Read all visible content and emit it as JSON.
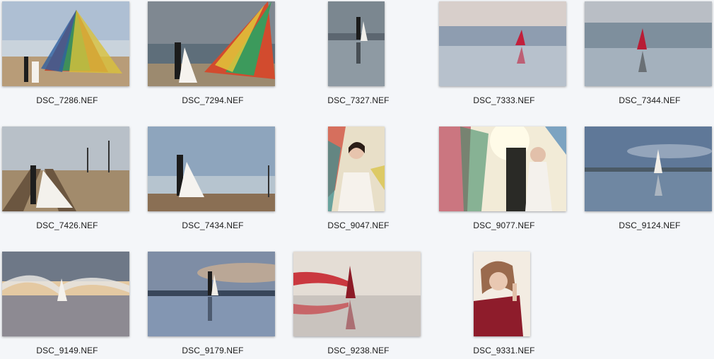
{
  "files": [
    {
      "name": "DSC_7286.NEF",
      "scene": "flags-beach"
    },
    {
      "name": "DSC_7294.NEF",
      "scene": "flags-cloudy"
    },
    {
      "name": "DSC_7327.NEF",
      "scene": "portrait-mirror-couple"
    },
    {
      "name": "DSC_7333.NEF",
      "scene": "mirror-red-dress"
    },
    {
      "name": "DSC_7344.NEF",
      "scene": "mirror-red-dress-2"
    },
    {
      "name": "DSC_7426.NEF",
      "scene": "railway-couple"
    },
    {
      "name": "DSC_7434.NEF",
      "scene": "railway-kiss"
    },
    {
      "name": "DSC_9047.NEF",
      "scene": "portrait-bride-flags"
    },
    {
      "name": "DSC_9077.NEF",
      "scene": "flags-kiss-sunlight"
    },
    {
      "name": "DSC_9124.NEF",
      "scene": "mirror-white-dress"
    },
    {
      "name": "DSC_9149.NEF",
      "scene": "veil-sunset"
    },
    {
      "name": "DSC_9179.NEF",
      "scene": "mirror-couple-sunset"
    },
    {
      "name": "DSC_9238.NEF",
      "scene": "red-veil-mirror"
    },
    {
      "name": "DSC_9331.NEF",
      "scene": "portrait-red-dress"
    }
  ],
  "colors": {
    "background": "#f4f6f9",
    "label": "#1a1a1a"
  }
}
